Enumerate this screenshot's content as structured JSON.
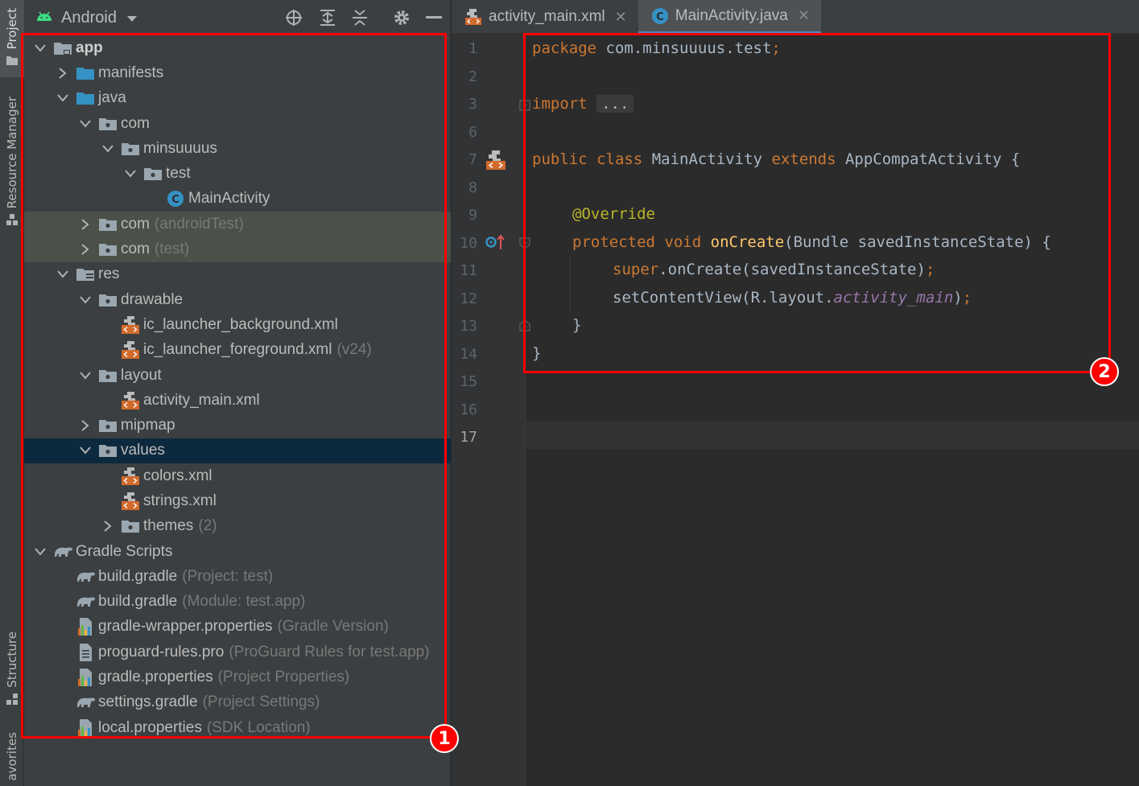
{
  "tool_strip": {
    "project": "Project",
    "resource_manager": "Resource Manager",
    "structure": "Structure",
    "favorites": "avorites"
  },
  "project_panel": {
    "view_mode": "Android",
    "tree": [
      {
        "name": "app",
        "bold": true,
        "hint": "",
        "expanded": true
      },
      {
        "name": "manifests",
        "hint": ""
      },
      {
        "name": "java",
        "hint": ""
      },
      {
        "name": "com",
        "hint": ""
      },
      {
        "name": "minsuuuus",
        "hint": ""
      },
      {
        "name": "test",
        "hint": ""
      },
      {
        "name": "MainActivity",
        "hint": ""
      },
      {
        "name": "com",
        "hint": "(androidTest)"
      },
      {
        "name": "com",
        "hint": "(test)"
      },
      {
        "name": "res",
        "hint": ""
      },
      {
        "name": "drawable",
        "hint": ""
      },
      {
        "name": "ic_launcher_background.xml",
        "hint": ""
      },
      {
        "name": "ic_launcher_foreground.xml",
        "hint": "(v24)"
      },
      {
        "name": "layout",
        "hint": ""
      },
      {
        "name": "activity_main.xml",
        "hint": ""
      },
      {
        "name": "mipmap",
        "hint": ""
      },
      {
        "name": "values",
        "hint": ""
      },
      {
        "name": "colors.xml",
        "hint": ""
      },
      {
        "name": "strings.xml",
        "hint": ""
      },
      {
        "name": "themes",
        "hint": "(2)"
      },
      {
        "name": "Gradle Scripts",
        "hint": ""
      },
      {
        "name": "build.gradle",
        "hint": "(Project: test)"
      },
      {
        "name": "build.gradle",
        "hint": "(Module: test.app)"
      },
      {
        "name": "gradle-wrapper.properties",
        "hint": "(Gradle Version)"
      },
      {
        "name": "proguard-rules.pro",
        "hint": "(ProGuard Rules for test.app)"
      },
      {
        "name": "gradle.properties",
        "hint": "(Project Properties)"
      },
      {
        "name": "settings.gradle",
        "hint": "(Project Settings)"
      },
      {
        "name": "local.properties",
        "hint": "(SDK Location)"
      }
    ]
  },
  "editor_tabs": [
    {
      "label": "activity_main.xml",
      "close": "✕"
    },
    {
      "label": "MainActivity.java",
      "close": "✕"
    }
  ],
  "editor": {
    "line_numbers": [
      "1",
      "2",
      "3",
      "6",
      "7",
      "8",
      "9",
      "10",
      "11",
      "12",
      "13",
      "14",
      "15",
      "16",
      "17"
    ],
    "code": {
      "l1_kw": "package",
      "l1_rest": " com.minsuuuus.test",
      "l1_semi": ";",
      "l3_kw": "import",
      "l3_fold": "...",
      "l7_kw1": "public",
      "l7_kw2": "class",
      "l7_name": " MainActivity ",
      "l7_kw3": "extends",
      "l7_rest": " AppCompatActivity {",
      "l9_ann": "@Override",
      "l10_kw1": "protected",
      "l10_kw2": "void",
      "l10_fn": "onCreate",
      "l10_rest": "(Bundle savedInstanceState) {",
      "l11_kw": "super",
      "l11_rest": ".onCreate(savedInstanceState)",
      "l11_semi": ";",
      "l12_a": "setContentView(R.layout.",
      "l12_fld": "activity_main",
      "l12_b": ")",
      "l12_semi": ";",
      "l13": "}",
      "l14": "}"
    }
  },
  "annotations": {
    "badge1": "1",
    "badge2": "2",
    "color": "#ff0000"
  },
  "colors": {
    "keyword": "#cc7832",
    "annotation": "#bbb529",
    "function": "#ffc66d",
    "field": "#9876aa",
    "selection": "#0d293e",
    "test_highlight": "#4b5148",
    "folder_blue": "#3592c4",
    "file_orange": "#d26a2d"
  }
}
